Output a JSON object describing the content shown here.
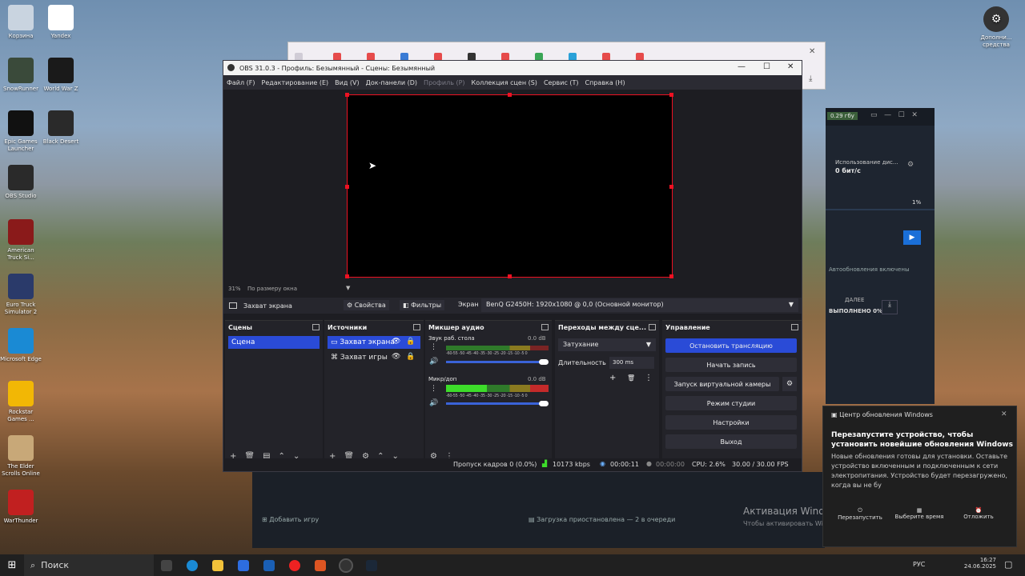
{
  "desktop_icons": [
    {
      "label": "Корзина",
      "icon": "recycle-bin-icon",
      "color": "#c9d4e0"
    },
    {
      "label": "Yandex",
      "icon": "yandex-icon",
      "color": "#ffffff"
    },
    {
      "label": "SnowRunner",
      "icon": "snowrunner-icon",
      "color": "#3a4a3a"
    },
    {
      "label": "World War Z",
      "icon": "wwz-icon",
      "color": "#1a1a1a"
    },
    {
      "label": "Epic Games Launcher",
      "icon": "epic-icon",
      "color": "#111111"
    },
    {
      "label": "Black Desert",
      "icon": "black-desert-icon",
      "color": "#2a2a2a"
    },
    {
      "label": "OBS Studio",
      "icon": "obs-icon",
      "color": "#2a2a2a"
    },
    {
      "label": "American Truck Si...",
      "icon": "ats-icon",
      "color": "#8a1a1a"
    },
    {
      "label": "Euro Truck Simulator 2",
      "icon": "ets-icon",
      "color": "#2a3a6a"
    },
    {
      "label": "Microsoft Edge",
      "icon": "edge-icon",
      "color": "#1a8ad4"
    },
    {
      "label": "Rockstar Games ...",
      "icon": "rockstar-icon",
      "color": "#f2b705"
    },
    {
      "label": "The Elder Scrolls Online",
      "icon": "eso-icon",
      "color": "#c8a878"
    },
    {
      "label": "WarThunder",
      "icon": "warthunder-icon",
      "color": "#c12020"
    }
  ],
  "top_right_icon_label": "Дополни... средства",
  "obs": {
    "title": "OBS 31.0.3 - Профиль: Безымянный - Сцены: Безымянный",
    "menu": [
      "Файл (F)",
      "Редактирование (E)",
      "Вид (V)",
      "Док-панели (D)",
      "Профиль (P)",
      "Коллекция сцен (S)",
      "Сервис (T)",
      "Справка (H)"
    ],
    "zoom_label": "31%",
    "zoom_mode": "По размеру окна",
    "context": {
      "source_name": "Захват экрана",
      "properties": "Свойства",
      "filters": "Фильтры",
      "screen_label": "Экран",
      "screen_value": "BenQ G2450H: 1920x1080 @ 0,0 (Основной монитор)"
    },
    "scenes": {
      "title": "Сцены",
      "items": [
        "Сцена"
      ]
    },
    "sources": {
      "title": "Источники",
      "items": [
        "Захват экрана",
        "Захват игры"
      ]
    },
    "mixer": {
      "title": "Микшер аудио",
      "channels": [
        {
          "name": "Звук раб. стола",
          "db": "0.0 dB",
          "level": 0.0
        },
        {
          "name": "Микр/доп",
          "db": "0.0 dB",
          "level": 0.4
        }
      ],
      "scale": "-60-55 -50 -45 -40 -35 -30 -25 -20 -15 -10 -5 0"
    },
    "transitions": {
      "title": "Переходы между сце...",
      "type": "Затухание",
      "duration_label": "Длительность",
      "duration_value": "300 ms"
    },
    "controls": {
      "title": "Управление",
      "buttons": [
        "Остановить трансляцию",
        "Начать запись",
        "Запуск виртуальной камеры",
        "Режим студии",
        "Настройки",
        "Выход"
      ]
    },
    "status": {
      "dropped": "Пропуск кадров 0 (0.0%)",
      "bitrate": "10173 kbps",
      "live_time": "00:00:11",
      "rec_time": "00:00:00",
      "cpu": "CPU: 2.6%",
      "fps": "30.00 / 30.00 FPS"
    }
  },
  "side_panel": {
    "badge": "0.29 гбу",
    "disk_title": "Использование дис...",
    "disk_value": "0 бит/с",
    "percent": "1%",
    "updates": "Автообновления включены",
    "next_label": "ДАЛЕЕ",
    "next_value": "ВЫПОЛНЕНО 0%"
  },
  "gamebar": {
    "add_game": "Добавить игру",
    "download_status": "Загрузка приостановлена — 2 в очереди"
  },
  "watermark": {
    "title": "Активация Windows",
    "text": "Чтобы активировать Windows, перейдите в раздел \"Параметры\"."
  },
  "notification": {
    "app": "Центр обновления Windows",
    "title": "Перезапустите устройство, чтобы установить новейшие обновления Windows",
    "body": "Новые обновления готовы для установки. Оставьте устройство включенным и подключенным к сети электропитания. Устройство будет перезагружено, когда вы не бу",
    "actions": [
      "Перезапустить",
      "Выберите время",
      "Отложить"
    ]
  },
  "taskbar": {
    "search": "Поиск",
    "lang": "РУС",
    "time": "16:27",
    "date": "24.06.2025"
  }
}
